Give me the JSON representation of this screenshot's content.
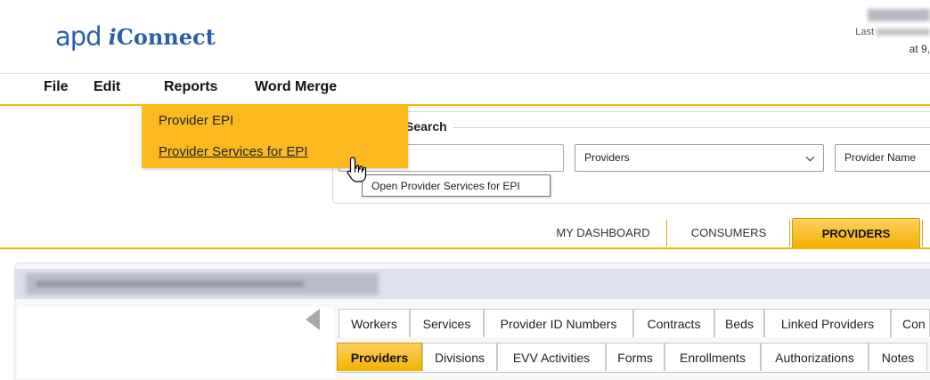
{
  "header": {
    "logo_prefix": "apd",
    "logo_i": "i",
    "logo_suffix": "Connect",
    "last_updated_label": "Last",
    "at_label": "at 9,"
  },
  "menu": {
    "items": [
      {
        "label": "File"
      },
      {
        "label": "Edit"
      },
      {
        "label": "Reports"
      },
      {
        "label": "Word Merge"
      }
    ]
  },
  "reports_dropdown": {
    "items": [
      {
        "label": "Provider EPI"
      },
      {
        "label": "Provider Services for EPI"
      }
    ]
  },
  "search": {
    "legend": "Search",
    "input_value": "",
    "type_select": "Providers",
    "field_select": "Provider Name"
  },
  "tooltip": {
    "text": "Open Provider Services for EPI"
  },
  "nav_tabs": [
    {
      "label": "MY DASHBOARD"
    },
    {
      "label": "CONSUMERS"
    },
    {
      "label": "PROVIDERS"
    }
  ],
  "sub_tabs_row1": [
    {
      "label": "Workers"
    },
    {
      "label": "Services"
    },
    {
      "label": "Provider ID Numbers"
    },
    {
      "label": "Contracts"
    },
    {
      "label": "Beds"
    },
    {
      "label": "Linked Providers"
    },
    {
      "label": "Con"
    }
  ],
  "sub_tabs_row2": [
    {
      "label": "Providers"
    },
    {
      "label": "Divisions"
    },
    {
      "label": "EVV Activities"
    },
    {
      "label": "Forms"
    },
    {
      "label": "Enrollments"
    },
    {
      "label": "Authorizations"
    },
    {
      "label": "Notes"
    }
  ],
  "colors": {
    "accent": "#f5b800",
    "dropdown_bg": "#fcba20",
    "logo_blue": "#2a5fa8",
    "title_bar": "#dde1ee"
  }
}
